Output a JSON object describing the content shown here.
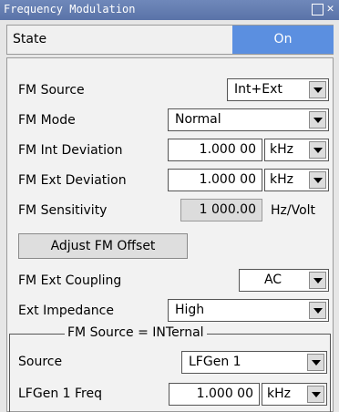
{
  "window": {
    "title": "Frequency Modulation"
  },
  "state": {
    "label": "State",
    "value": "On"
  },
  "fm_source": {
    "label": "FM Source",
    "value": "Int+Ext"
  },
  "fm_mode": {
    "label": "FM Mode",
    "value": "Normal"
  },
  "fm_int_deviation": {
    "label": "FM Int Deviation",
    "value": "1.000 00",
    "unit": "kHz"
  },
  "fm_ext_deviation": {
    "label": "FM Ext Deviation",
    "value": "1.000 00",
    "unit": "kHz"
  },
  "fm_sensitivity": {
    "label": "FM Sensitivity",
    "value": "1 000.00",
    "unit": "Hz/Volt"
  },
  "adjust_button": {
    "label": "Adjust FM Offset"
  },
  "fm_ext_coupling": {
    "label": "FM Ext Coupling",
    "value": "AC"
  },
  "ext_impedance": {
    "label": "Ext Impedance",
    "value": "High"
  },
  "internal_group": {
    "title": "FM Source = INTernal",
    "source": {
      "label": "Source",
      "value": "LFGen 1"
    },
    "lfgen_freq": {
      "label": "LFGen 1 Freq",
      "value": "1.000 00",
      "unit": "kHz"
    }
  }
}
